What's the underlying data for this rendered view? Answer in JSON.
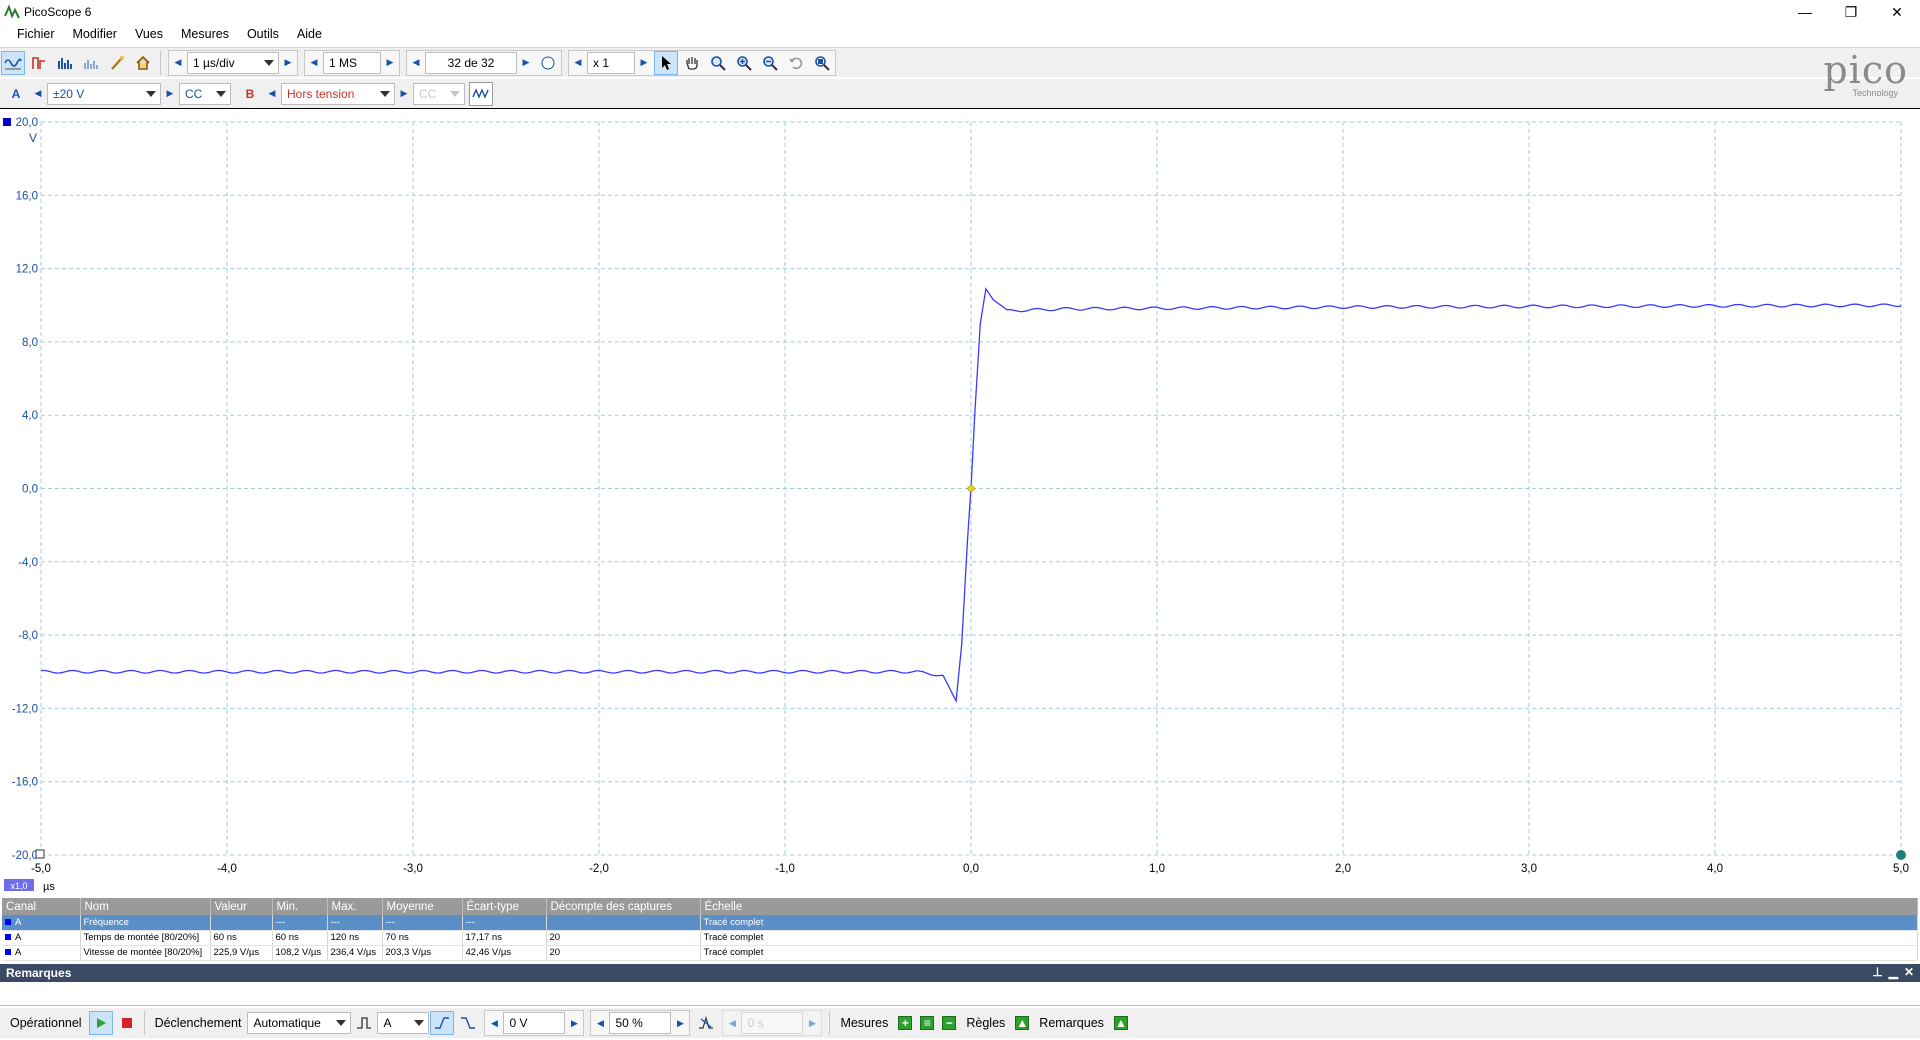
{
  "window": {
    "title": "PicoScope 6",
    "minimize_glyph": "—",
    "restore_glyph": "❐",
    "close_glyph": "✕"
  },
  "menu": [
    "Fichier",
    "Modifier",
    "Vues",
    "Mesures",
    "Outils",
    "Aide"
  ],
  "toolbar1": {
    "timebase": "1 µs/div",
    "samples": "1 MS",
    "buffer": "32 de 32",
    "zoom": "x 1"
  },
  "toolbar2": {
    "channel_a_label": "A",
    "channel_a_range": "±20 V",
    "channel_a_coupling": "CC",
    "channel_b_label": "B",
    "channel_b_range": "Hors tension",
    "channel_b_coupling": "CC"
  },
  "logo": {
    "word": "pico",
    "sub": "Technology"
  },
  "scope": {
    "y_unit": "V",
    "x_unit": "µs",
    "x_scale_badge": "x1,0",
    "colors": {
      "trace": "#3a3aff",
      "grid": "#9fcfe0",
      "trigger": "#e8d22a",
      "channel": "#0000c8"
    }
  },
  "chart_data": {
    "type": "line",
    "xlabel": "µs",
    "ylabel": "V",
    "xlim": [
      -5.0,
      5.0
    ],
    "ylim": [
      -20.0,
      20.0
    ],
    "x_ticks": [
      -5.0,
      -4.0,
      -3.0,
      -2.0,
      -1.0,
      0.0,
      1.0,
      2.0,
      3.0,
      4.0,
      5.0
    ],
    "x_tick_labels": [
      "-5,0",
      "-4,0",
      "-3,0",
      "-2,0",
      "-1,0",
      "0,0",
      "1,0",
      "2,0",
      "3,0",
      "4,0",
      "5,0"
    ],
    "y_ticks": [
      20.0,
      16.0,
      12.0,
      8.0,
      4.0,
      0.0,
      -4.0,
      -8.0,
      -12.0,
      -16.0,
      -20.0
    ],
    "y_tick_labels": [
      "20,0",
      "16,0",
      "12,0",
      "8,0",
      "4,0",
      "0,0",
      "-4,0",
      "-8,0",
      "-12,0",
      "-16,0",
      "-20,0"
    ],
    "grid": true,
    "series": [
      {
        "name": "A",
        "x": [
          -5.0,
          -2.0,
          -0.3,
          -0.15,
          -0.11,
          -0.08,
          -0.05,
          -0.02,
          0.0,
          0.02,
          0.05,
          0.08,
          0.12,
          0.2,
          0.5,
          2.0,
          5.0
        ],
        "y": [
          -10.0,
          -10.0,
          -10.0,
          -10.2,
          -11.0,
          -11.6,
          -8.5,
          -3.0,
          0.0,
          4.0,
          9.0,
          10.9,
          10.3,
          9.7,
          9.8,
          9.9,
          10.0
        ]
      }
    ],
    "trigger_point": {
      "x": 0.0,
      "y": 0.0
    }
  },
  "measurements": {
    "headers": [
      "Canal",
      "Nom",
      "Valeur",
      "Min.",
      "Max.",
      "Moyenne",
      "Écart-type",
      "Décompte des captures",
      "Échelle"
    ],
    "rows": [
      [
        "A",
        "Fréquence",
        "",
        "---",
        "---",
        "---",
        "---",
        "",
        "Tracé complet"
      ],
      [
        "A",
        "Temps de montée  [80/20%]",
        "60 ns",
        "60 ns",
        "120 ns",
        "70 ns",
        "17,17 ns",
        "20",
        "Tracé complet"
      ],
      [
        "A",
        "Vitesse de montée  [80/20%]",
        "225,9 V/µs",
        "108,2 V/µs",
        "236,4 V/µs",
        "203,3 V/µs",
        "42,46 V/µs",
        "20",
        "Tracé complet"
      ]
    ]
  },
  "remarks": {
    "title": "Remarques"
  },
  "statusbar": {
    "mode": "Opérationnel",
    "trigger_label": "Déclenchement",
    "trigger_mode": "Automatique",
    "trigger_channel": "A",
    "threshold": "0 V",
    "pretrigger": "50 %",
    "delay": "0 s",
    "measures_label": "Mesures",
    "rules_label": "Règles",
    "remarks_label": "Remarques"
  }
}
